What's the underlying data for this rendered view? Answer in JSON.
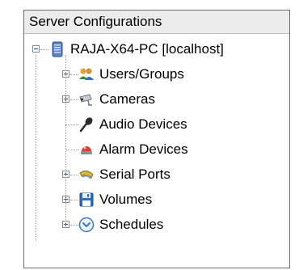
{
  "header": {
    "title": "Server Configurations"
  },
  "tree": {
    "root": {
      "label": "RAJA-X64-PC [localhost]",
      "icon": "server-icon",
      "expanded": true
    },
    "children": [
      {
        "label": "Users/Groups",
        "icon": "users-icon",
        "expandable": true
      },
      {
        "label": "Cameras",
        "icon": "camera-icon",
        "expandable": true
      },
      {
        "label": "Audio Devices",
        "icon": "microphone-icon",
        "expandable": false
      },
      {
        "label": "Alarm Devices",
        "icon": "alarm-icon",
        "expandable": false
      },
      {
        "label": "Serial Ports",
        "icon": "serial-port-icon",
        "expandable": true
      },
      {
        "label": "Volumes",
        "icon": "floppy-disk-icon",
        "expandable": true
      },
      {
        "label": "Schedules",
        "icon": "schedule-icon",
        "expandable": true
      }
    ]
  }
}
